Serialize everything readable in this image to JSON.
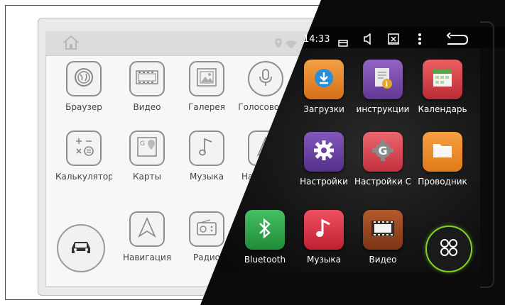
{
  "status_bar": {
    "time": "14:33"
  },
  "apps_light": [
    {
      "label": "Браузер",
      "icon": "globe-icon"
    },
    {
      "label": "Видео",
      "icon": "film-icon"
    },
    {
      "label": "Галерея",
      "icon": "picture-icon"
    },
    {
      "label": "Голосовой п",
      "icon": "microphone-icon"
    },
    {
      "label": "Калькулятор",
      "icon": "calculator-icon"
    },
    {
      "label": "Карты",
      "icon": "map-icon"
    },
    {
      "label": "Музыка",
      "icon": "music-note-icon"
    },
    {
      "label": "Навигация",
      "icon": "navigation-arrow-icon"
    },
    {
      "label": "Навигация",
      "icon": "navigation-arrow-icon"
    },
    {
      "label": "Радио",
      "icon": "radio-icon"
    }
  ],
  "apps_dark": [
    {
      "label": "Загрузки",
      "icon": "download-icon",
      "color": "#e8872a"
    },
    {
      "label": "инструкции",
      "icon": "info-icon",
      "color": "#7b4ea8"
    },
    {
      "label": "Календарь",
      "icon": "calendar-icon",
      "color": "#d9434b"
    },
    {
      "label": "Настройки",
      "icon": "gear-icon",
      "color": "#6c3fa8"
    },
    {
      "label": "Настройки С",
      "icon": "google-icon",
      "color": "#d84a55"
    },
    {
      "label": "Проводник",
      "icon": "folder-icon",
      "color": "#f08a26"
    },
    {
      "label": "Bluetooth",
      "icon": "bluetooth-icon",
      "color": "#2fa84a"
    },
    {
      "label": "Музыка",
      "icon": "music-note-icon",
      "color": "#e03a4a"
    },
    {
      "label": "Видео",
      "icon": "film-icon",
      "color": "#9a4a24"
    }
  ],
  "colors": {
    "dark_background": "#0b0b0b",
    "light_background": "#f7f7f7",
    "accent_green": "#7ed321"
  }
}
